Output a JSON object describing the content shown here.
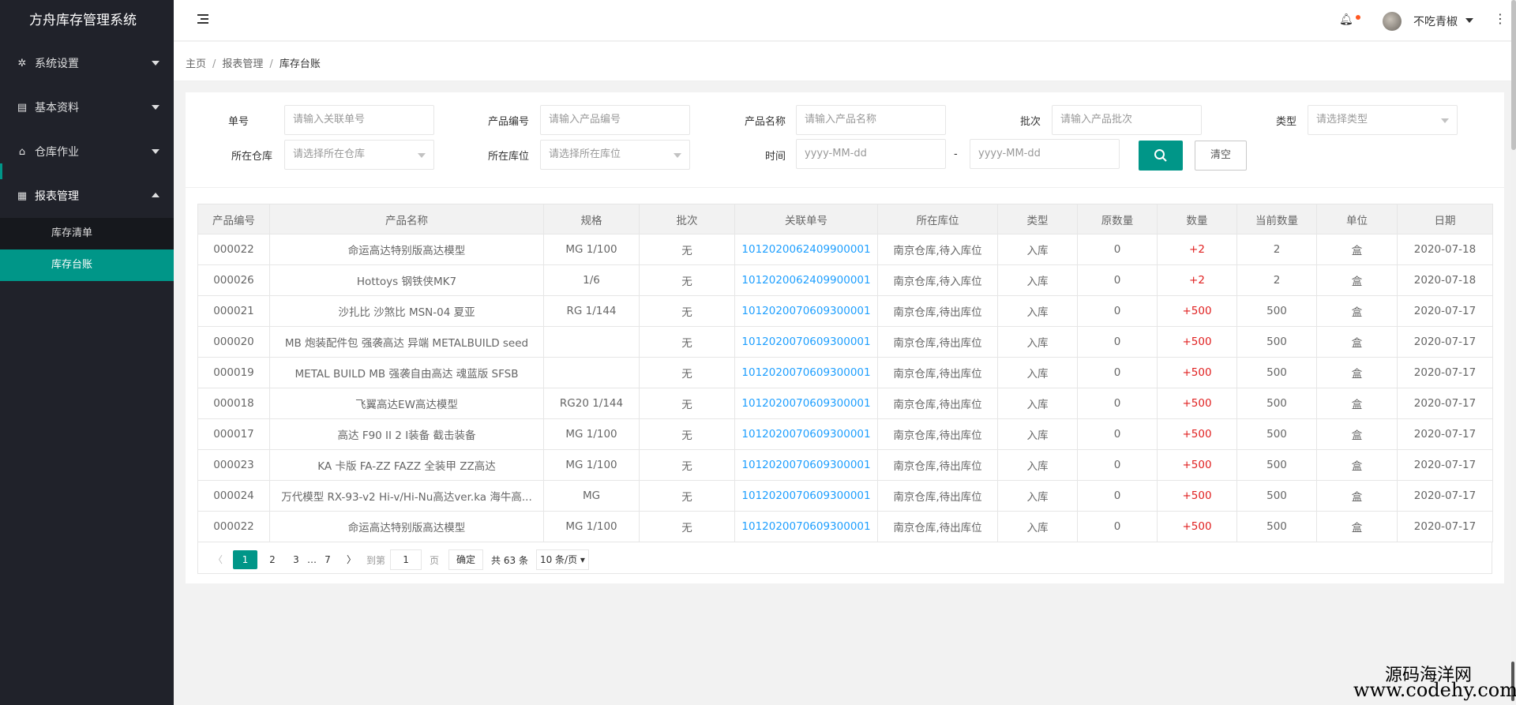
{
  "app": {
    "title": "方舟库存管理系统"
  },
  "sidebar": {
    "items": [
      {
        "label": "系统设置",
        "icon": "gear-icon"
      },
      {
        "label": "基本资料",
        "icon": "document-icon"
      },
      {
        "label": "仓库作业",
        "icon": "home-icon"
      },
      {
        "label": "报表管理",
        "icon": "table-icon"
      }
    ],
    "sub_items": [
      {
        "label": "库存清单"
      },
      {
        "label": "库存台账"
      }
    ]
  },
  "header": {
    "username": "不吃青椒",
    "icons": [
      "menu-icon",
      "bell-icon",
      "more-icon"
    ]
  },
  "breadcrumb": {
    "home": "主页",
    "section": "报表管理",
    "current": "库存台账"
  },
  "search": {
    "order_label": "单号",
    "order_placeholder": "请输入关联单号",
    "code_label": "产品编号",
    "code_placeholder": "请输入产品编号",
    "name_label": "产品名称",
    "name_placeholder": "请输入产品名称",
    "batch_label": "批次",
    "batch_placeholder": "请输入产品批次",
    "type_label": "类型",
    "type_placeholder": "请选择类型",
    "warehouse_label": "所在仓库",
    "warehouse_placeholder": "请选择所在仓库",
    "location_label": "所在库位",
    "location_placeholder": "请选择所在库位",
    "time_label": "时间",
    "date_start_placeholder": "yyyy-MM-dd",
    "date_end_placeholder": "yyyy-MM-dd",
    "dash": "-",
    "clear_label": "清空"
  },
  "table": {
    "headers": [
      "产品编号",
      "产品名称",
      "规格",
      "批次",
      "关联单号",
      "所在库位",
      "类型",
      "原数量",
      "数量",
      "当前数量",
      "单位",
      "日期"
    ],
    "rows": [
      [
        "000022",
        "命运高达特别版高达模型",
        "MG 1/100",
        "无",
        "1012020062409900001",
        "南京仓库,待入库位",
        "入库",
        "0",
        "+2",
        "2",
        "盒",
        "2020-07-18"
      ],
      [
        "000026",
        "Hottoys 钢铁侠MK7",
        "1/6",
        "无",
        "1012020062409900001",
        "南京仓库,待入库位",
        "入库",
        "0",
        "+2",
        "2",
        "盒",
        "2020-07-18"
      ],
      [
        "000021",
        "沙扎比 沙煞比 MSN-04 夏亚",
        "RG 1/144",
        "无",
        "1012020070609300001",
        "南京仓库,待出库位",
        "入库",
        "0",
        "+500",
        "500",
        "盒",
        "2020-07-17"
      ],
      [
        "000020",
        "MB 炮装配件包 强袭高达 异端 METALBUILD seed",
        "",
        "无",
        "1012020070609300001",
        "南京仓库,待出库位",
        "入库",
        "0",
        "+500",
        "500",
        "盒",
        "2020-07-17"
      ],
      [
        "000019",
        "METAL BUILD MB 强袭自由高达 魂蓝版 SFSB",
        "",
        "无",
        "1012020070609300001",
        "南京仓库,待出库位",
        "入库",
        "0",
        "+500",
        "500",
        "盒",
        "2020-07-17"
      ],
      [
        "000018",
        "飞翼高达EW高达模型",
        "RG20 1/144",
        "无",
        "1012020070609300001",
        "南京仓库,待出库位",
        "入库",
        "0",
        "+500",
        "500",
        "盒",
        "2020-07-17"
      ],
      [
        "000017",
        "高达 F90 II 2 I装备 截击装备",
        "MG 1/100",
        "无",
        "1012020070609300001",
        "南京仓库,待出库位",
        "入库",
        "0",
        "+500",
        "500",
        "盒",
        "2020-07-17"
      ],
      [
        "000023",
        "KA 卡版 FA-ZZ FAZZ 全装甲 ZZ高达",
        "MG 1/100",
        "无",
        "1012020070609300001",
        "南京仓库,待出库位",
        "入库",
        "0",
        "+500",
        "500",
        "盒",
        "2020-07-17"
      ],
      [
        "000024",
        "万代模型 RX-93-v2 Hi-v/Hi-Nu高达ver.ka 海牛高...",
        "MG",
        "无",
        "1012020070609300001",
        "南京仓库,待出库位",
        "入库",
        "0",
        "+500",
        "500",
        "盒",
        "2020-07-17"
      ],
      [
        "000022",
        "命运高达特别版高达模型",
        "MG 1/100",
        "无",
        "1012020070609300001",
        "南京仓库,待出库位",
        "入库",
        "0",
        "+500",
        "500",
        "盒",
        "2020-07-17"
      ]
    ]
  },
  "pagination": {
    "prev": "〈",
    "pages": [
      "1",
      "2",
      "3"
    ],
    "ellipsis": "…",
    "last": "7",
    "next": "〉",
    "goto_label": "到第",
    "goto_value": "1",
    "page_unit": "页",
    "confirm": "确定",
    "total": "共 63 条",
    "page_size": "10 条/页"
  },
  "watermark": {
    "line1": "源码海洋网",
    "line2": "www.codehy.com"
  },
  "colors": {
    "accent": "#009688",
    "sidebar": "#20222a",
    "link": "#1e9fff",
    "plus": "#e02020"
  }
}
